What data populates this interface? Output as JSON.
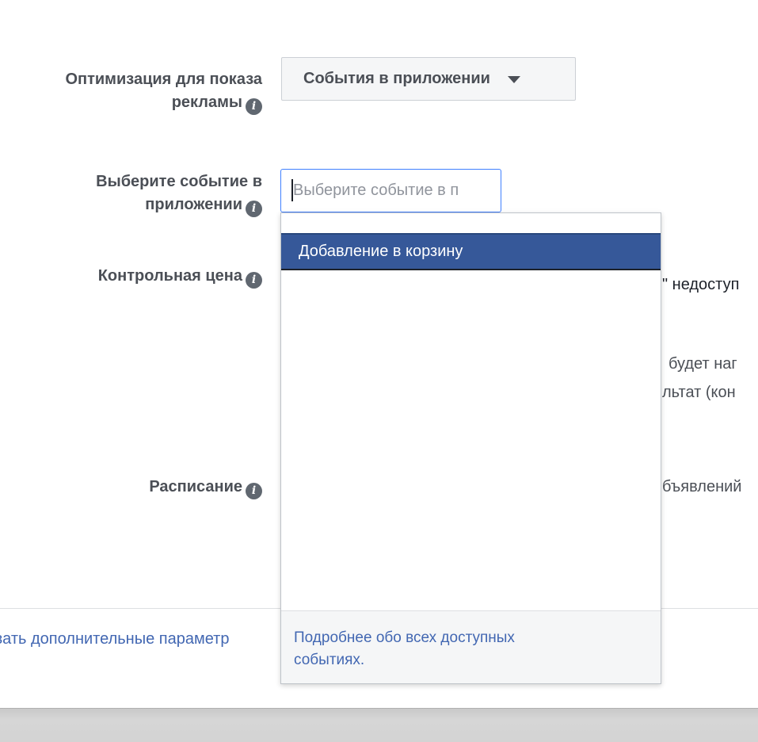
{
  "optimization": {
    "label_line1": "Оптимизация для показа",
    "label_line2": "рекламы",
    "button_label": "События в приложении"
  },
  "event_select": {
    "label_line1": "Выберите событие в",
    "label_line2": "приложении",
    "placeholder": "Выберите событие в п"
  },
  "control_price": {
    "label": "Контрольная цена",
    "partial_text": "\" недоступ"
  },
  "background_text": {
    "line_a": "будет наг",
    "line_b": "льтат (кон"
  },
  "schedule": {
    "label": "Расписание",
    "partial_text": "бъявлений"
  },
  "footer": {
    "more_params_link": "зать дополнительные параметр"
  },
  "dropdown": {
    "options": [
      {
        "label": "Добавление в корзину",
        "highlighted": true
      }
    ],
    "footer_line1": "Подробнее обо всех доступных",
    "footer_line2": "событиях."
  },
  "icons": {
    "info": "info-icon",
    "caret": "caret-down-icon"
  },
  "colors": {
    "accent": "#4267b2",
    "highlight": "#365899",
    "label_text": "#4b4f56"
  }
}
